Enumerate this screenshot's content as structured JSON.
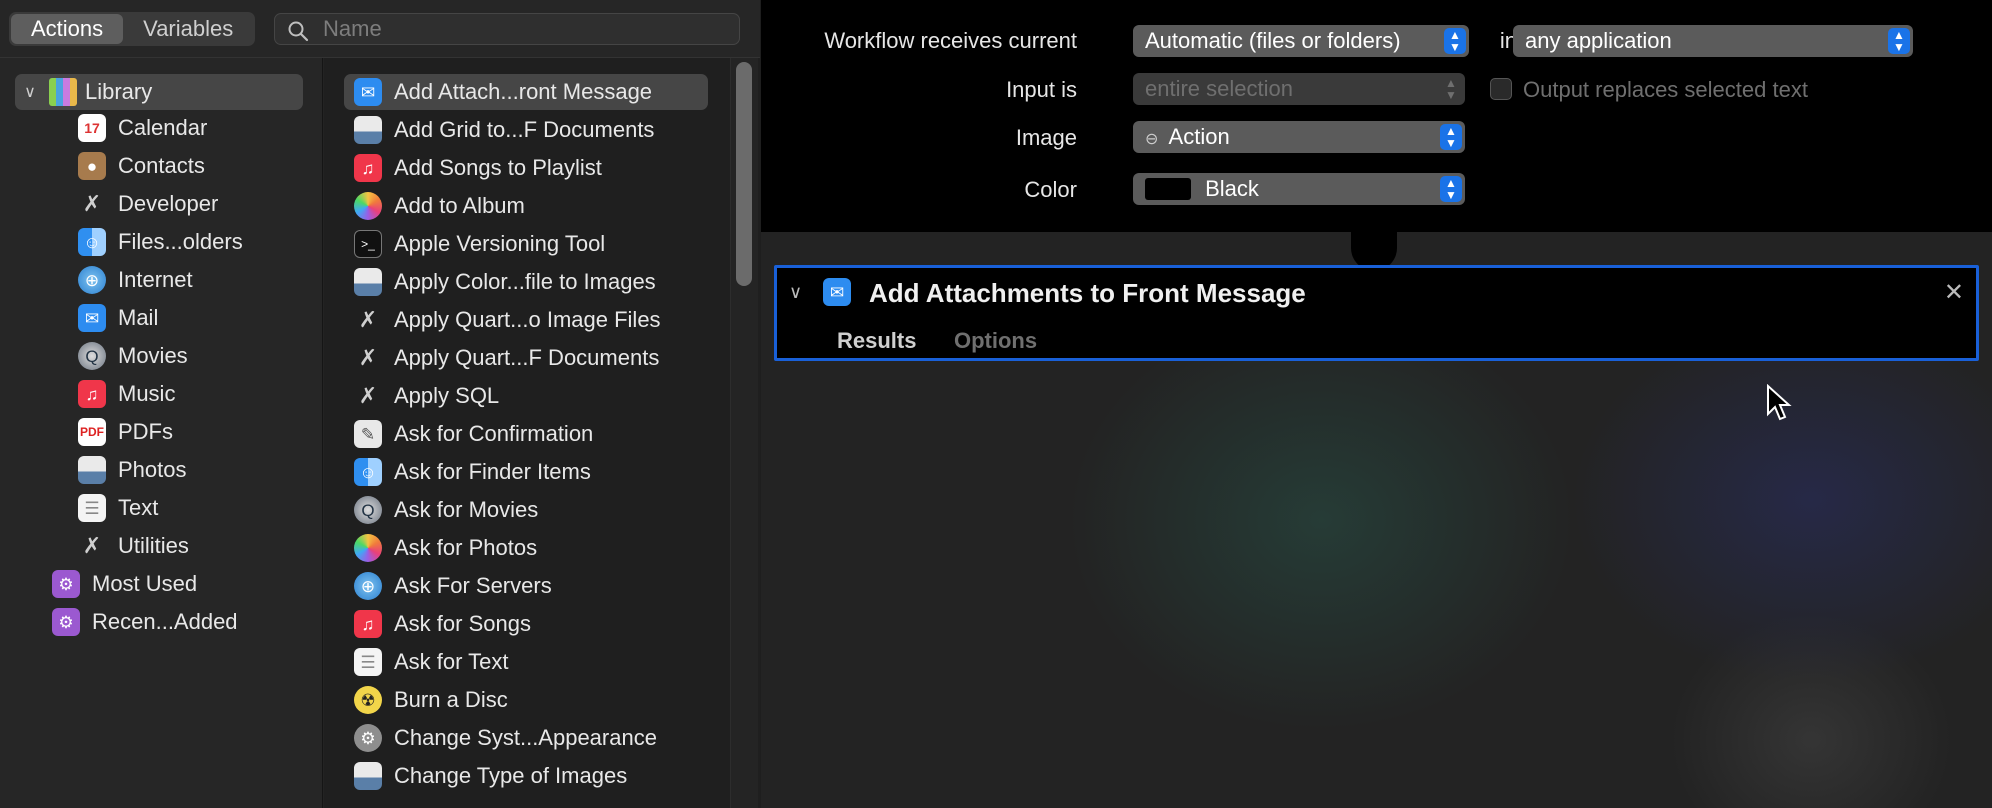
{
  "toolbar": {
    "tabs": [
      "Actions",
      "Variables"
    ],
    "search_placeholder": "Name"
  },
  "library": {
    "root": "Library",
    "categories": [
      "Calendar",
      "Contacts",
      "Developer",
      "Files...olders",
      "Internet",
      "Mail",
      "Movies",
      "Music",
      "PDFs",
      "Photos",
      "Text",
      "Utilities"
    ],
    "smart_groups": [
      "Most Used",
      "Recen...Added"
    ]
  },
  "actions": [
    "Add Attach...ront Message",
    "Add Grid to...F Documents",
    "Add Songs to Playlist",
    "Add to Album",
    "Apple Versioning Tool",
    "Apply Color...file to Images",
    "Apply Quart...o Image Files",
    "Apply Quart...F Documents",
    "Apply SQL",
    "Ask for Confirmation",
    "Ask for Finder Items",
    "Ask for Movies",
    "Ask for Photos",
    "Ask For Servers",
    "Ask for Songs",
    "Ask for Text",
    "Burn a Disc",
    "Change Syst...Appearance",
    "Change Type of Images"
  ],
  "workflow": {
    "receives_label": "Workflow receives current",
    "receives_value": "Automatic (files or folders)",
    "in_label": "in",
    "app_value": "any application",
    "input_label": "Input is",
    "input_value": "entire selection",
    "output_label": "Output replaces selected text",
    "image_label": "Image",
    "image_value": "Action",
    "color_label": "Color",
    "color_value": "Black"
  },
  "action_card": {
    "title": "Add Attachments to Front Message",
    "tabs": [
      "Results",
      "Options"
    ]
  }
}
